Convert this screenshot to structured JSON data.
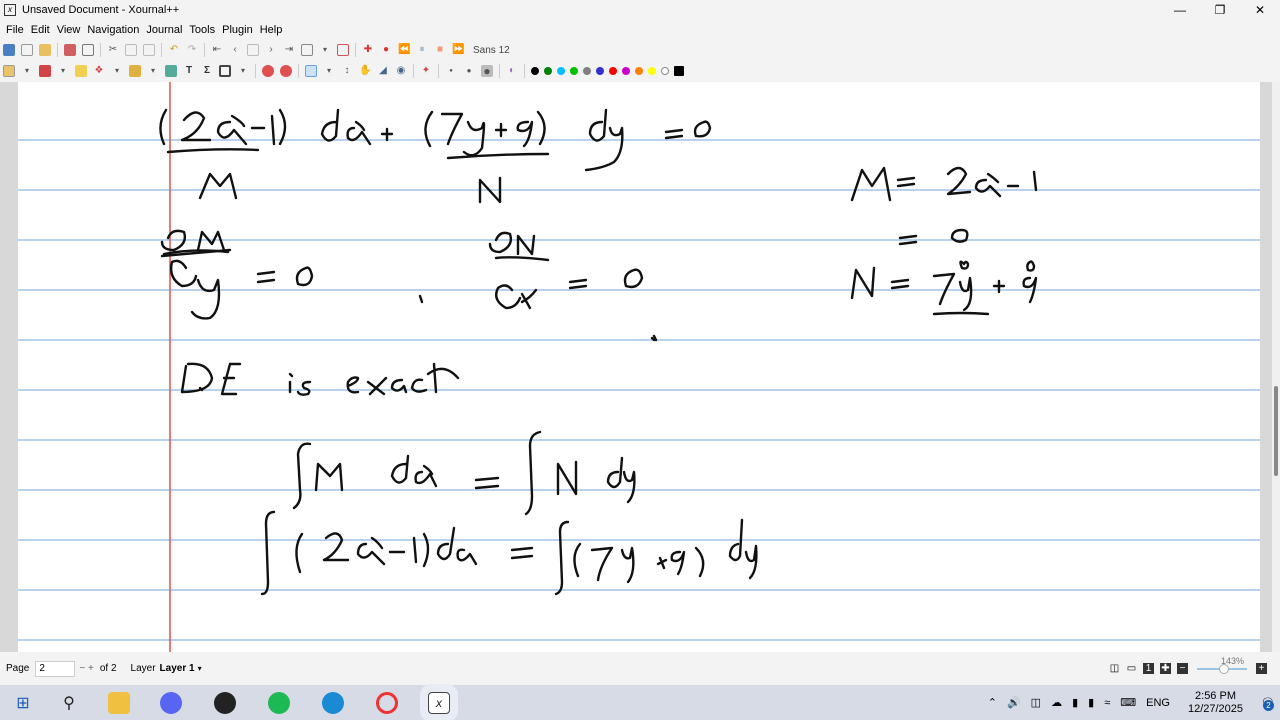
{
  "window": {
    "title": "Unsaved Document - Xournal++",
    "app_icon": "xournal-icon"
  },
  "menu": [
    "File",
    "Edit",
    "View",
    "Navigation",
    "Journal",
    "Tools",
    "Plugin",
    "Help"
  ],
  "toolbar": {
    "font": "Sans 12"
  },
  "colors": {
    "ruling": "#8fb6df",
    "margin_line": "#e05050",
    "palette": [
      "#000000",
      "#008000",
      "#00c0ff",
      "#00c000",
      "#808080",
      "#3333cc",
      "#ff0000",
      "#cc00cc",
      "#ff8000",
      "#ffff00",
      "#ffffff",
      "#000000"
    ]
  },
  "status": {
    "page_label": "Page",
    "page_value": "2",
    "page_total": "of 2",
    "layer_label": "Layer",
    "layer_value": "Layer 1",
    "zoom": "143%"
  },
  "taskbar": {
    "lang": "ENG",
    "time": "2:56 PM",
    "date": "12/27/2025",
    "notifications": "2"
  }
}
